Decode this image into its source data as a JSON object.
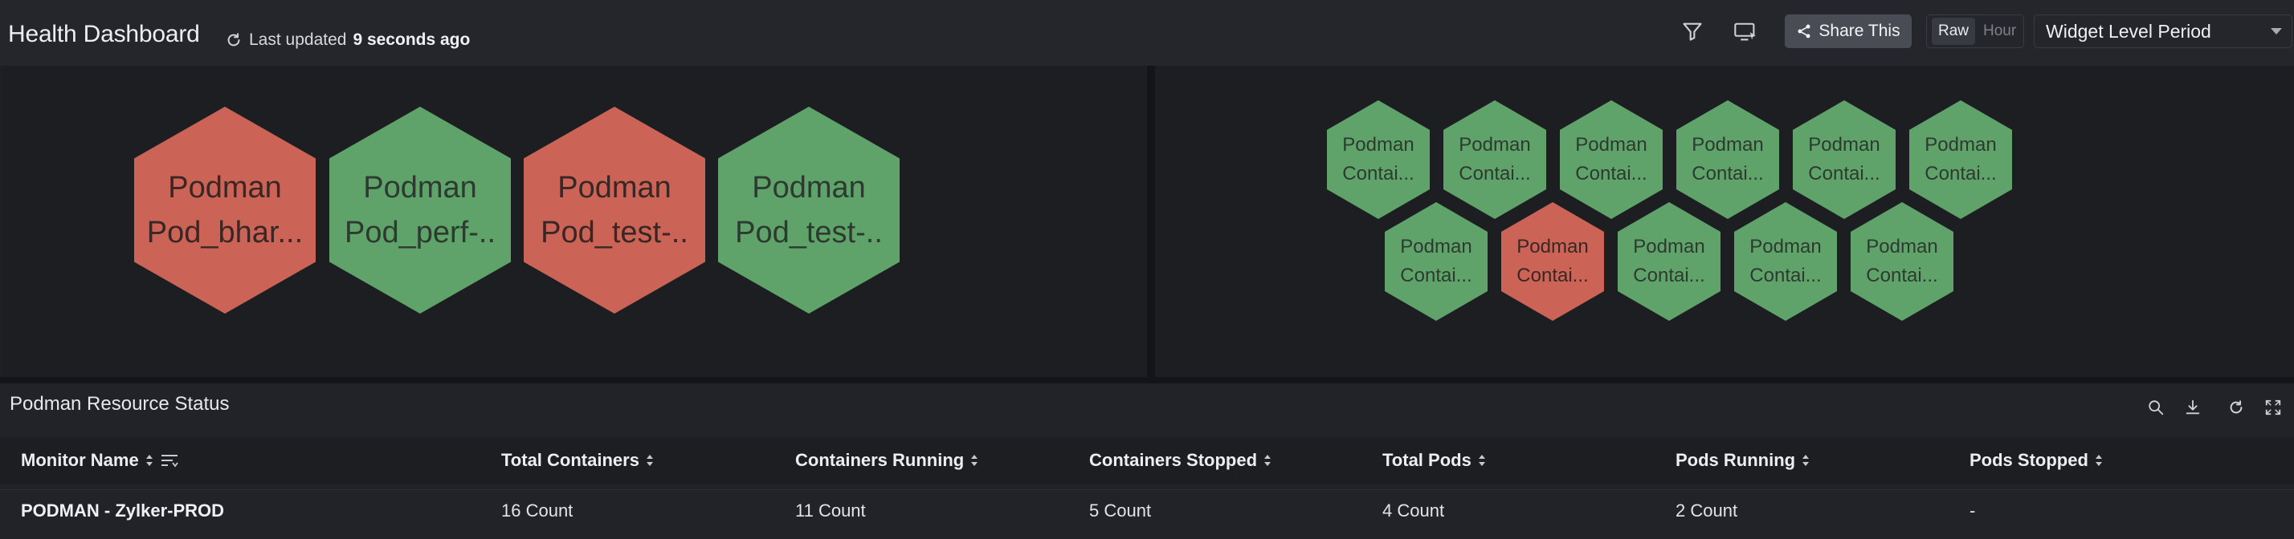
{
  "header": {
    "title": "Health Dashboard",
    "last_updated_prefix": "Last updated",
    "last_updated_value": "9 seconds ago",
    "share_label": "Share This",
    "period_raw": "Raw",
    "period_hour": "Hour",
    "period_select": "Widget Level Period"
  },
  "pods_widget": {
    "items": [
      {
        "line1": "Podman",
        "line2": "Pod_bhar...",
        "status": "red"
      },
      {
        "line1": "Podman",
        "line2": "Pod_perf-..",
        "status": "green"
      },
      {
        "line1": "Podman",
        "line2": "Pod_test-..",
        "status": "red"
      },
      {
        "line1": "Podman",
        "line2": "Pod_test-..",
        "status": "green"
      }
    ]
  },
  "containers_widget": {
    "items": [
      {
        "line1": "Podman",
        "line2": "Contai...",
        "status": "green"
      },
      {
        "line1": "Podman",
        "line2": "Contai...",
        "status": "green"
      },
      {
        "line1": "Podman",
        "line2": "Contai...",
        "status": "green"
      },
      {
        "line1": "Podman",
        "line2": "Contai...",
        "status": "green"
      },
      {
        "line1": "Podman",
        "line2": "Contai...",
        "status": "green"
      },
      {
        "line1": "Podman",
        "line2": "Contai...",
        "status": "green"
      },
      {
        "line1": "Podman",
        "line2": "Contai...",
        "status": "green"
      },
      {
        "line1": "Podman",
        "line2": "Contai...",
        "status": "red"
      },
      {
        "line1": "Podman",
        "line2": "Contai...",
        "status": "green"
      },
      {
        "line1": "Podman",
        "line2": "Contai...",
        "status": "green"
      },
      {
        "line1": "Podman",
        "line2": "Contai...",
        "status": "green"
      }
    ]
  },
  "resource_table": {
    "title": "Podman Resource Status",
    "columns": [
      "Monitor Name",
      "Total Containers",
      "Containers Running",
      "Containers Stopped",
      "Total Pods",
      "Pods Running",
      "Pods Stopped"
    ],
    "rows": [
      [
        "PODMAN - Zylker-PROD",
        "16 Count",
        "11 Count",
        "5 Count",
        "4 Count",
        "2 Count",
        "-"
      ]
    ]
  },
  "colors": {
    "status_green": "#5fa36a",
    "status_red": "#cb6457",
    "background": "#1f2024"
  },
  "icons": [
    "refresh-icon",
    "filter-icon",
    "display-icon",
    "share-icon",
    "search-icon",
    "download-icon",
    "reload-icon",
    "fullscreen-icon",
    "sort-icon",
    "column-settings-icon"
  ]
}
